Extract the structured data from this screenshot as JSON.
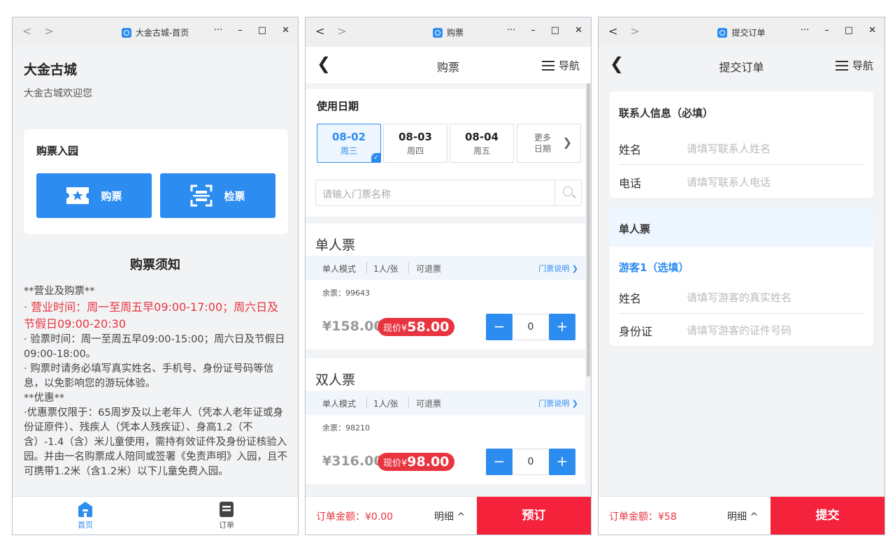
{
  "win1": {
    "title": "大金古城-首页",
    "site_title": "大金古城",
    "welcome": "大金古城欢迎您",
    "buy_section_title": "购票入园",
    "buy_button": "购票",
    "check_button": "检票",
    "notice_title": "购票须知",
    "notice_lines": {
      "l1": "**营业及购票**",
      "l2": "· 营业时间：周一至周五早09:00-17:00；周六日及节假日09:00-20:30",
      "l3": "· 验票时间：周一至周五早09:00-15:00；周六日及节假日09:00-18:00。",
      "l4": "· 购票时请务必填写真实姓名、手机号、身份证号码等信息，以免影响您的游玩体验。",
      "l5": "**优惠**",
      "l6": "·优惠票仅限于：65周岁及以上老年人（凭本人老年证或身份证原件）、残疾人（凭本人残疾证）、身高1.2（不含）-1.4（含）米儿童使用，需持有效证件及身份证核验入园。并由一名购票成人陪同或签署《免责声明》入园，且不可携带1.2米（含1.2米）以下儿童免费入园。"
    },
    "tabs": {
      "home": "首页",
      "order": "订单"
    }
  },
  "win2": {
    "title": "购票",
    "page_title": "购票",
    "nav_label": "导航",
    "date_label": "使用日期",
    "dates": [
      {
        "date": "08-02",
        "weekday": "周三",
        "selected": true
      },
      {
        "date": "08-03",
        "weekday": "周四",
        "selected": false
      },
      {
        "date": "08-04",
        "weekday": "周五",
        "selected": false
      }
    ],
    "more_dates": "更多日期",
    "search_placeholder": "请输入门票名称",
    "tickets": [
      {
        "name": "单人票",
        "mode": "单人模式",
        "per": "1人/张",
        "refund": "可退票",
        "info_link": "门票说明",
        "remaining": "余票：99643",
        "orig_price": "¥158.00",
        "now_label": "现价¥",
        "now_price": "58.00",
        "qty": "0"
      },
      {
        "name": "双人票",
        "mode": "单人模式",
        "per": "1人/张",
        "refund": "可退票",
        "info_link": "门票说明",
        "remaining": "余票：98210",
        "orig_price": "¥316.00",
        "now_label": "现价¥",
        "now_price": "98.00",
        "qty": "0"
      }
    ],
    "order_amount": "订单金额：¥0.00",
    "detail": "明细 ^",
    "submit": "预订"
  },
  "win3": {
    "title": "提交订单",
    "page_title": "提交订单",
    "nav_label": "导航",
    "contact_head": "联系人信息（必填）",
    "contact_name_label": "姓名",
    "contact_name_ph": "请填写联系人姓名",
    "contact_phone_label": "电话",
    "contact_phone_ph": "请填写联系人电话",
    "ticket_head": "单人票",
    "guest_head": "游客1（选填）",
    "guest_name_label": "姓名",
    "guest_name_ph": "请填写游客的真实姓名",
    "guest_id_label": "身份证",
    "guest_id_ph": "请填写游客的证件号码",
    "order_amount": "订单金额：¥58",
    "detail": "明细 ^",
    "submit": "提交"
  },
  "colors": {
    "accent": "#2d8cf0",
    "price_red": "#e8343f",
    "cta_red": "#f5223b"
  },
  "icons": [
    "back-icon",
    "forward-icon",
    "menu-icon",
    "search-icon",
    "ticket-icon",
    "scan-icon",
    "home-icon",
    "order-icon",
    "chevron-right-icon"
  ]
}
